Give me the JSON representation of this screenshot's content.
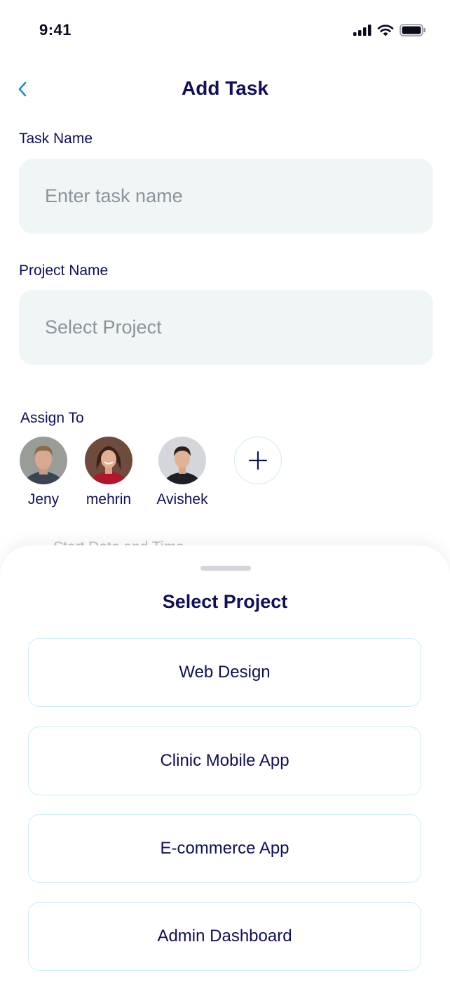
{
  "status_bar": {
    "time": "9:41"
  },
  "header": {
    "title": "Add Task"
  },
  "form": {
    "task_name_label": "Task Name",
    "task_name_placeholder": "Enter task name",
    "project_name_label": "Project Name",
    "project_placeholder": "Select Project",
    "assign_label": "Assign To",
    "assignees": [
      {
        "name": "Jeny"
      },
      {
        "name": "mehrin"
      },
      {
        "name": "Avishek"
      }
    ],
    "partially_hidden_label": "Start Date and Time"
  },
  "sheet": {
    "title": "Select Project",
    "options": [
      {
        "label": "Web Design"
      },
      {
        "label": "Clinic Mobile App"
      },
      {
        "label": "E-commerce App"
      },
      {
        "label": "Admin Dashboard"
      }
    ]
  },
  "colors": {
    "primary_text": "#0f0f5c",
    "field_bg": "#f0f5f5",
    "placeholder": "#8c939b",
    "accent_border": "#cdeef6",
    "back_icon": "#1f8fc9"
  },
  "icons": [
    "signal-icon",
    "wifi-icon",
    "battery-icon",
    "back-chevron-icon",
    "plus-icon"
  ]
}
